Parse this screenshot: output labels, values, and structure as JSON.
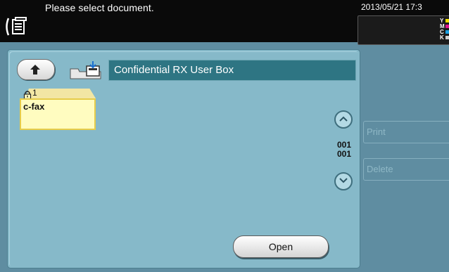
{
  "header": {
    "message": "Please select document.",
    "datetime": "2013/05/21 17:3",
    "toner": [
      {
        "letter": "Y",
        "color": "#f0e000"
      },
      {
        "letter": "M",
        "color": "#e0148c"
      },
      {
        "letter": "C",
        "color": "#1a9fe0"
      },
      {
        "letter": "K",
        "color": "#d0d0d0"
      }
    ]
  },
  "panel": {
    "title": "Confidential RX User Box"
  },
  "document": {
    "number": "1",
    "name": "c-fax"
  },
  "pagination": {
    "current": "001",
    "total": "001"
  },
  "buttons": {
    "open": "Open",
    "print": "Print",
    "delete": "Delete"
  },
  "colors": {
    "screen_bg": "#5f8da1",
    "panel_bg": "#86b9c9",
    "title_bar": "#2e7583",
    "doc_fill": "#fffcc0",
    "doc_border": "#e6cc4a"
  }
}
